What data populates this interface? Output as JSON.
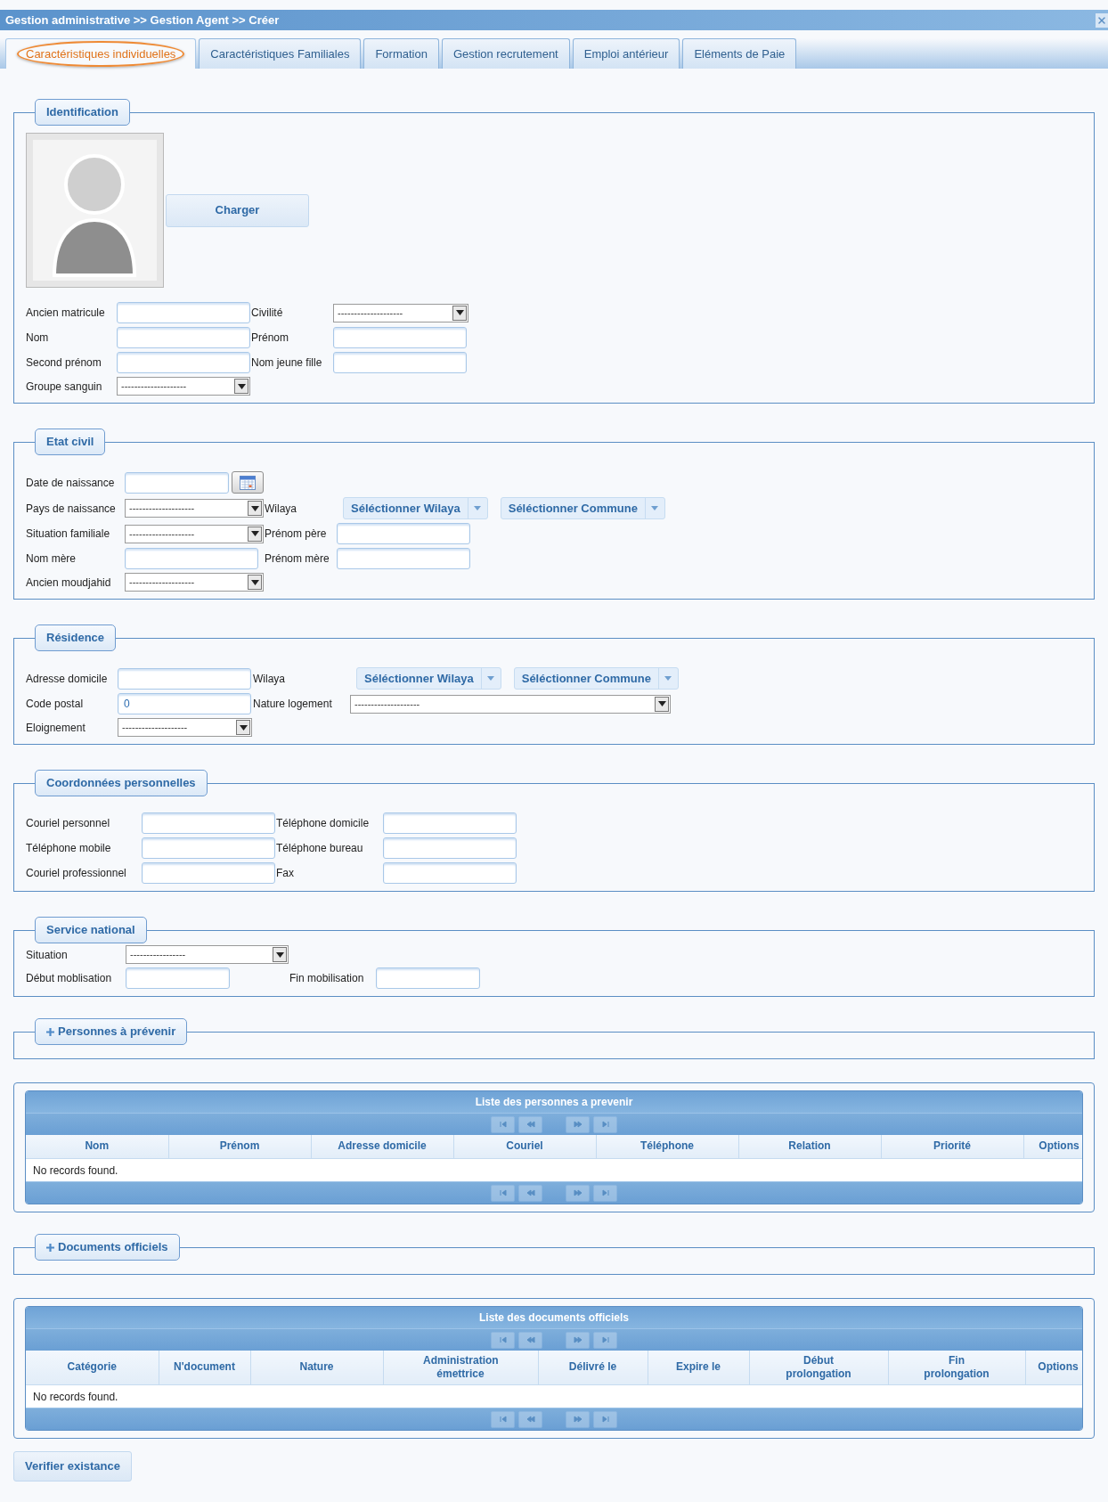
{
  "header": {
    "breadcrumb": "Gestion administrative >> Gestion Agent >> Créer"
  },
  "tabs": [
    {
      "label": "Caractéristiques individuelles",
      "selected": true
    },
    {
      "label": "Caractéristiques Familiales",
      "selected": false
    },
    {
      "label": "Formation",
      "selected": false
    },
    {
      "label": "Gestion recrutement",
      "selected": false
    },
    {
      "label": "Emploi antérieur",
      "selected": false
    },
    {
      "label": "Eléments de Paie",
      "selected": false
    }
  ],
  "sections": [
    {
      "kind": "form",
      "legend": "Identification",
      "photo": {
        "button": "Charger"
      },
      "rows": [
        [
          {
            "label": "Ancien matricule",
            "kind": "text"
          },
          {
            "label": "Civilité",
            "kind": "select",
            "value": "--------------------"
          }
        ],
        [
          {
            "label": "Nom",
            "kind": "text"
          },
          {
            "label": "Prénom",
            "kind": "text"
          }
        ],
        [
          {
            "label": "Second prénom",
            "kind": "text"
          },
          {
            "label": "Nom jeune fille",
            "kind": "text"
          }
        ],
        [
          {
            "label": "Groupe sanguin",
            "kind": "select",
            "value": "--------------------"
          }
        ]
      ]
    },
    {
      "kind": "form",
      "legend": "Etat civil",
      "rows": [
        [
          {
            "label": "Date de naissance",
            "kind": "date"
          }
        ],
        [
          {
            "label": "Pays de naissance",
            "kind": "select",
            "value": "--------------------"
          },
          {
            "label": "Wilaya",
            "kind": "choosers",
            "buttons": [
              "Séléctionner Wilaya",
              "Séléctionner Commune"
            ]
          }
        ],
        [
          {
            "label": "Situation familiale",
            "kind": "select",
            "value": "--------------------"
          },
          {
            "label": "Prénom père",
            "kind": "text"
          }
        ],
        [
          {
            "label": "Nom mère",
            "kind": "text"
          },
          {
            "label": "Prénom mère",
            "kind": "text"
          }
        ],
        [
          {
            "label": "Ancien moudjahid",
            "kind": "select",
            "value": "--------------------"
          }
        ]
      ]
    },
    {
      "kind": "form",
      "legend": "Résidence",
      "rows": [
        [
          {
            "label": "Adresse domicile",
            "kind": "text"
          },
          {
            "label": "Wilaya",
            "kind": "choosers",
            "buttons": [
              "Séléctionner Wilaya",
              "Séléctionner Commune"
            ]
          }
        ],
        [
          {
            "label": "Code postal",
            "kind": "text",
            "value": "0"
          },
          {
            "label": "Nature logement",
            "kind": "select",
            "value": "--------------------"
          }
        ],
        [
          {
            "label": "Eloignement",
            "kind": "select",
            "value": "--------------------"
          }
        ]
      ]
    },
    {
      "kind": "form",
      "legend": "Coordonnées personnelles",
      "rows": [
        [
          {
            "label": "Couriel personnel",
            "kind": "text"
          },
          {
            "label": "Téléphone domicile",
            "kind": "text"
          }
        ],
        [
          {
            "label": "Téléphone mobile",
            "kind": "text"
          },
          {
            "label": "Téléphone bureau",
            "kind": "text"
          }
        ],
        [
          {
            "label": "Couriel professionnel",
            "kind": "text"
          },
          {
            "label": "Fax",
            "kind": "text"
          }
        ]
      ]
    },
    {
      "kind": "form",
      "legend": "Service national",
      "rows": [
        [
          {
            "label": "Situation",
            "kind": "select",
            "value": "-----------------"
          }
        ],
        [
          {
            "label": "Début moblisation",
            "kind": "text"
          },
          {
            "label": "Fin mobilisation",
            "kind": "text"
          }
        ]
      ]
    },
    {
      "kind": "collapsible",
      "legend": "Personnes à prévenir",
      "expanded": false
    },
    {
      "kind": "table",
      "title": "Liste des personnes a prevenir",
      "pager_disabled": true,
      "columns": [
        "Nom",
        "Prénom",
        "Adresse domicile",
        "Couriel",
        "Téléphone",
        "Relation",
        "Priorité",
        "Options"
      ],
      "empty": "No records found."
    },
    {
      "kind": "collapsible",
      "legend": "Documents officiels",
      "expanded": false
    },
    {
      "kind": "table",
      "title": "Liste des documents officiels",
      "pager_disabled": true,
      "columns": [
        "Catégorie",
        "N'document",
        "Nature",
        "Administration émettrice",
        "Délivré le",
        "Expire le",
        "Début prolongation",
        "Fin prolongation",
        "Options"
      ],
      "empty": "No records found."
    }
  ],
  "actions": [
    {
      "label": "Verifier existance"
    }
  ]
}
